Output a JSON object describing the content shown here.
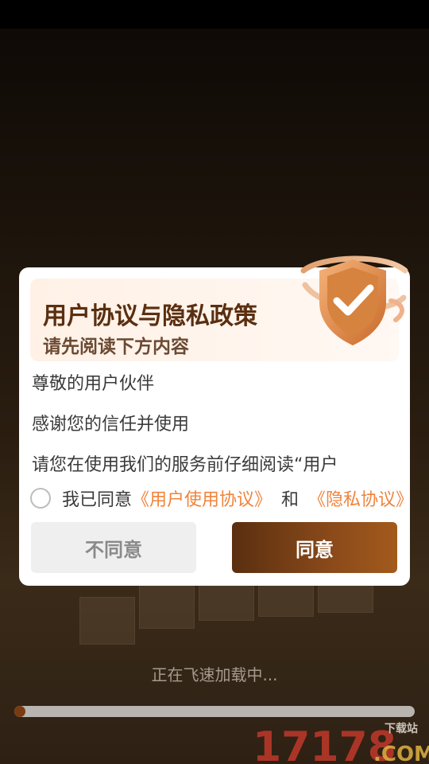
{
  "dialog": {
    "title": "用户协议与隐私政策",
    "subtitle": "请先阅读下方内容",
    "body_lines": [
      "尊敬的用户伙伴",
      "感谢您的信任并使用",
      "请您在使用我们的服务前仔细阅读“用户"
    ],
    "agree_prefix": "我已同意",
    "user_agreement_link": "《用户使用协议》",
    "and_text": "和",
    "privacy_link": "《隐私协议》",
    "disagree_label": "不同意",
    "agree_label": "同意",
    "checkbox_checked": false
  },
  "loading": {
    "text": "正在飞速加载中...",
    "progress": 0.02
  },
  "watermark": {
    "number": "17178",
    "domain": ".COM",
    "tag": "下载站"
  },
  "colors": {
    "brand_dark": "#5a2f10",
    "link_orange": "#f0843c",
    "agree_gradient_end": "#a35a1c"
  }
}
